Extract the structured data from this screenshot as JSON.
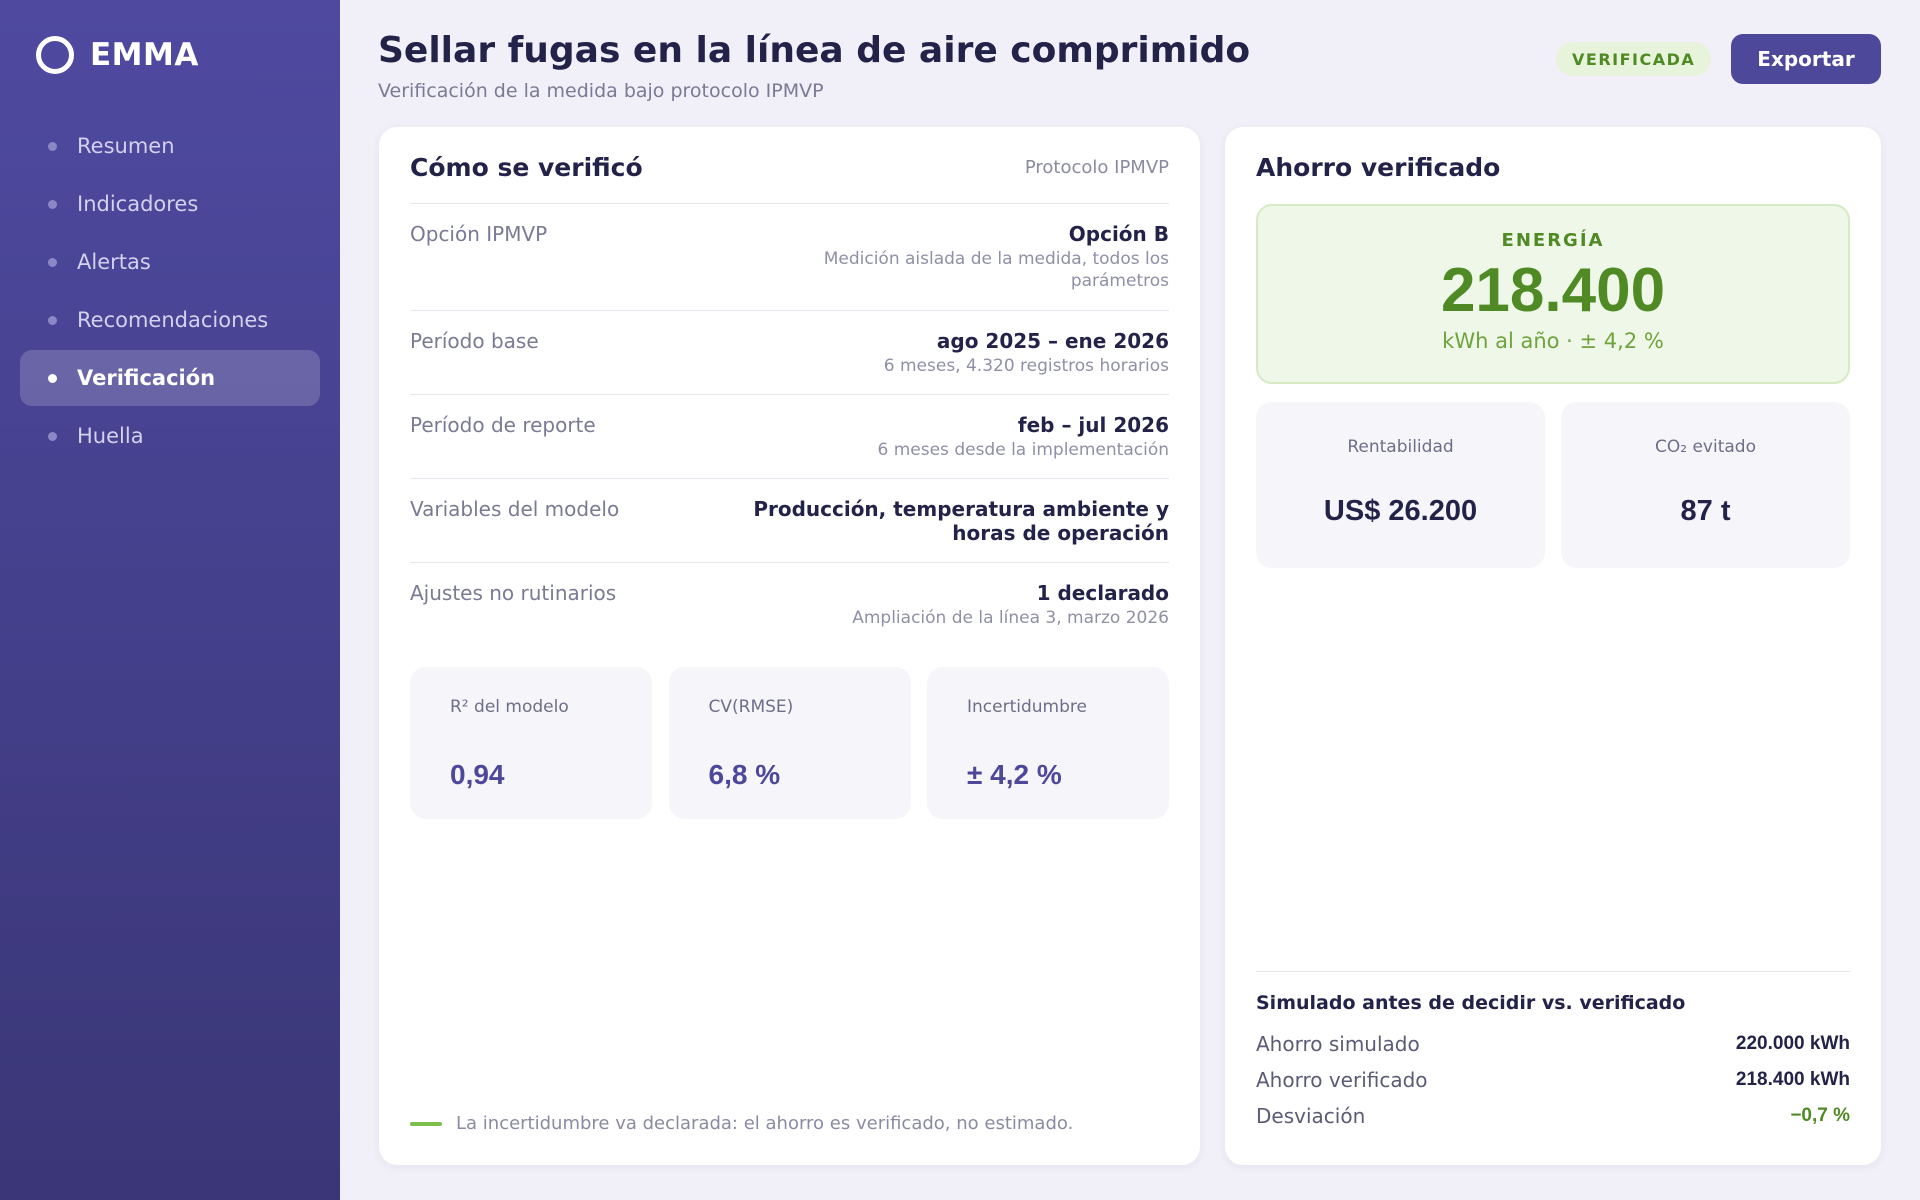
{
  "app": {
    "name": "EMMA"
  },
  "sidebar": {
    "items": [
      {
        "label": "Resumen",
        "active": false
      },
      {
        "label": "Indicadores",
        "active": false
      },
      {
        "label": "Alertas",
        "active": false
      },
      {
        "label": "Recomendaciones",
        "active": false
      },
      {
        "label": "Verificación",
        "active": true
      },
      {
        "label": "Huella",
        "active": false
      }
    ]
  },
  "header": {
    "title": "Sellar fugas en la línea de aire comprimido",
    "subtitle": "Verificación de la medida bajo protocolo IPMVP",
    "status": "VERIFICADA",
    "export_label": "Exportar"
  },
  "verification": {
    "title": "Cómo se verificó",
    "tag": "Protocolo IPMVP",
    "rows": [
      {
        "label": "Opción IPMVP",
        "value": "Opción B",
        "sub": "Medición aislada de la medida, todos los parámetros"
      },
      {
        "label": "Período base",
        "value": "ago 2025 – ene 2026",
        "sub": "6 meses, 4.320 registros horarios"
      },
      {
        "label": "Período de reporte",
        "value": "feb – jul 2026",
        "sub": "6 meses desde la implementación"
      },
      {
        "label": "Variables del modelo",
        "value": "Producción, temperatura ambiente y horas de operación",
        "sub": ""
      },
      {
        "label": "Ajustes no rutinarios",
        "value": "1 declarado",
        "sub": "Ampliación de la línea 3, marzo 2026"
      }
    ],
    "metrics": [
      {
        "label": "R² del modelo",
        "value": "0,94"
      },
      {
        "label": "CV(RMSE)",
        "value": "6,8 %"
      },
      {
        "label": "Incertidumbre",
        "value": "± 4,2 %"
      }
    ],
    "footnote": "La incertidumbre va declarada: el ahorro es verificado, no estimado."
  },
  "savings": {
    "title": "Ahorro verificado",
    "energy_label": "ENERGÍA",
    "energy_value": "218.400",
    "energy_sub": "kWh al año · ± 4,2 %",
    "kpis": [
      {
        "label": "Rentabilidad",
        "value": "US$ 26.200"
      },
      {
        "label": "CO₂ evitado",
        "value": "87 t"
      }
    ],
    "compare": {
      "title": "Simulado antes de decidir vs. verificado",
      "rows": [
        {
          "label": "Ahorro simulado",
          "value": "220.000 kWh"
        },
        {
          "label": "Ahorro verificado",
          "value": "218.400 kWh"
        },
        {
          "label": "Desviación",
          "value": "−0,7 %"
        }
      ]
    }
  },
  "colors": {
    "sidebar_top": "#4f4aa0",
    "sidebar_bottom": "#3a3677",
    "accent": "#4d4899",
    "success": "#4f8a24",
    "background": "#f1f0f8"
  }
}
